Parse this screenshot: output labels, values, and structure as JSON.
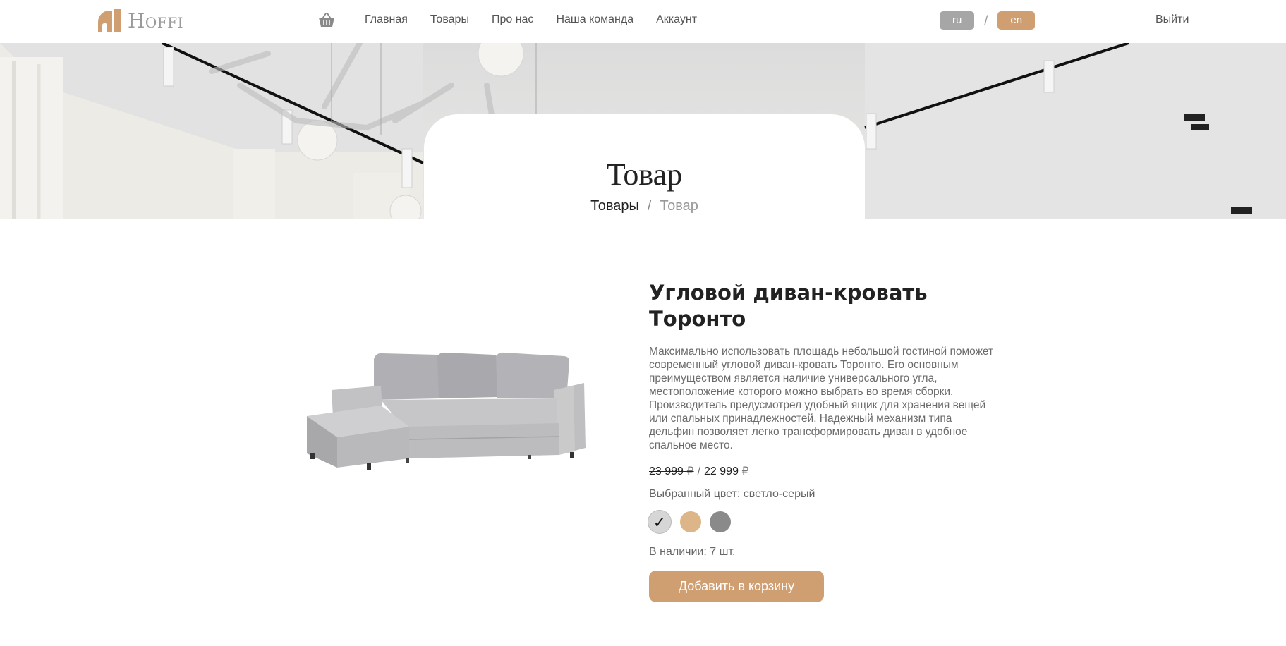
{
  "brand": {
    "logo_text": "Hoffi",
    "accent": "#cf9f72"
  },
  "nav": {
    "cart_icon": "basket-icon",
    "items": [
      {
        "label": "Главная"
      },
      {
        "label": "Товары"
      },
      {
        "label": "Про нас"
      },
      {
        "label": "Наша команда"
      },
      {
        "label": "Аккаунт"
      }
    ],
    "languages": {
      "ru": "ru",
      "separator": "/",
      "en": "en"
    },
    "logout": "Выйти"
  },
  "hero": {
    "title": "Товар",
    "breadcrumb": {
      "parent": "Товары",
      "separator": "/",
      "current": "Товар"
    }
  },
  "product": {
    "title": "Угловой диван-кровать Торонто",
    "description": "Максимально использовать площадь небольшой гостиной поможет современный угловой диван-кровать Торонто. Его основным преимуществом является наличие универсального угла, местоположение которого можно выбрать во время сборки. Производитель предусмотрел удобный ящик для хранения вещей или спальных принадлежностей. Надежный механизм типа дельфин позволяет легко трансформировать диван в удобное спальное место.",
    "price_old": "23 999",
    "price_sep": "/",
    "price_new": "22 999",
    "currency": "₽",
    "color_label": "Выбранный цвет: светло-серый",
    "colors": [
      {
        "name": "светло-серый",
        "hex": "#d6d6d6",
        "selected": true,
        "check": "✓"
      },
      {
        "name": "бежевый",
        "hex": "#dcb688",
        "selected": false
      },
      {
        "name": "серый",
        "hex": "#8a8a8a",
        "selected": false
      }
    ],
    "stock": "В наличии: 7 шт.",
    "add_to_cart": "Добавить в корзину"
  }
}
